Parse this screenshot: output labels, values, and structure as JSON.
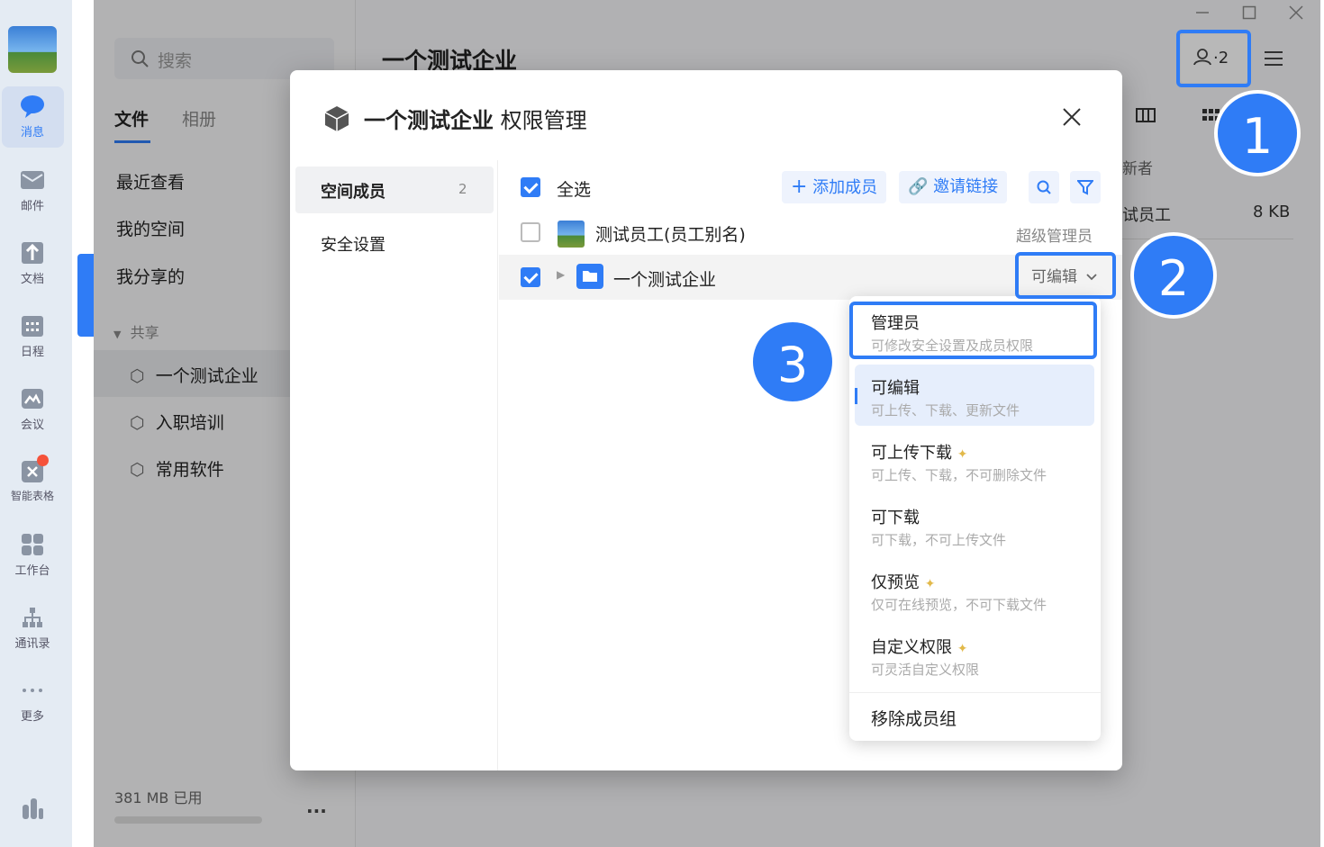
{
  "rail": {
    "items": [
      {
        "label": "消息",
        "icon": "chat-icon"
      },
      {
        "label": "邮件",
        "icon": "mail-icon"
      },
      {
        "label": "文档",
        "icon": "doc-icon"
      },
      {
        "label": "日程",
        "icon": "calendar-icon"
      },
      {
        "label": "会议",
        "icon": "meeting-icon"
      },
      {
        "label": "智能表格",
        "icon": "smart-table-icon"
      },
      {
        "label": "工作台",
        "icon": "workbench-icon"
      },
      {
        "label": "通讯录",
        "icon": "contacts-icon"
      },
      {
        "label": "更多",
        "icon": "more-icon"
      }
    ]
  },
  "sidebar": {
    "search_placeholder": "搜索",
    "tabs": [
      "文件",
      "相册"
    ],
    "nav": [
      "最近查看",
      "我的空间",
      "我分享的"
    ],
    "shared_header": "共享",
    "spaces": [
      "一个测试企业",
      "入职培训",
      "常用软件"
    ],
    "storage": "381 MB 已用",
    "more": "..."
  },
  "header": {
    "title": "一个测试企业",
    "member_count": "2",
    "col_header": "新者",
    "row_name": "试员工",
    "row_size": "8 KB"
  },
  "dialog": {
    "title_bold": "一个测试企业",
    "title_rest": "权限管理",
    "close": "×",
    "side": [
      {
        "label": "空间成员",
        "count": "2"
      },
      {
        "label": "安全设置",
        "count": ""
      }
    ],
    "select_all": "全选",
    "add_member": "添加成员",
    "invite_link": "邀请链接",
    "members": [
      {
        "name": "测试员工(员工别名)",
        "role": "超级管理员"
      },
      {
        "name": "一个测试企业",
        "role": "可编辑"
      }
    ]
  },
  "dropdown": {
    "items": [
      {
        "title": "管理员",
        "desc": "可修改安全设置及成员权限",
        "star": false
      },
      {
        "title": "可编辑",
        "desc": "可上传、下载、更新文件",
        "star": false
      },
      {
        "title": "可上传下载",
        "desc": "可上传、下载，不可删除文件",
        "star": true
      },
      {
        "title": "可下载",
        "desc": "可下载，不可上传文件",
        "star": false
      },
      {
        "title": "仅预览",
        "desc": "仅可在线预览，不可下载文件",
        "star": true
      },
      {
        "title": "自定义权限",
        "desc": "可灵活自定义权限",
        "star": true
      }
    ],
    "remove": "移除成员组"
  },
  "badges": [
    "1",
    "2",
    "3"
  ],
  "colors": {
    "accent": "#2f7cf6",
    "selected_bg": "#e6eefc"
  }
}
